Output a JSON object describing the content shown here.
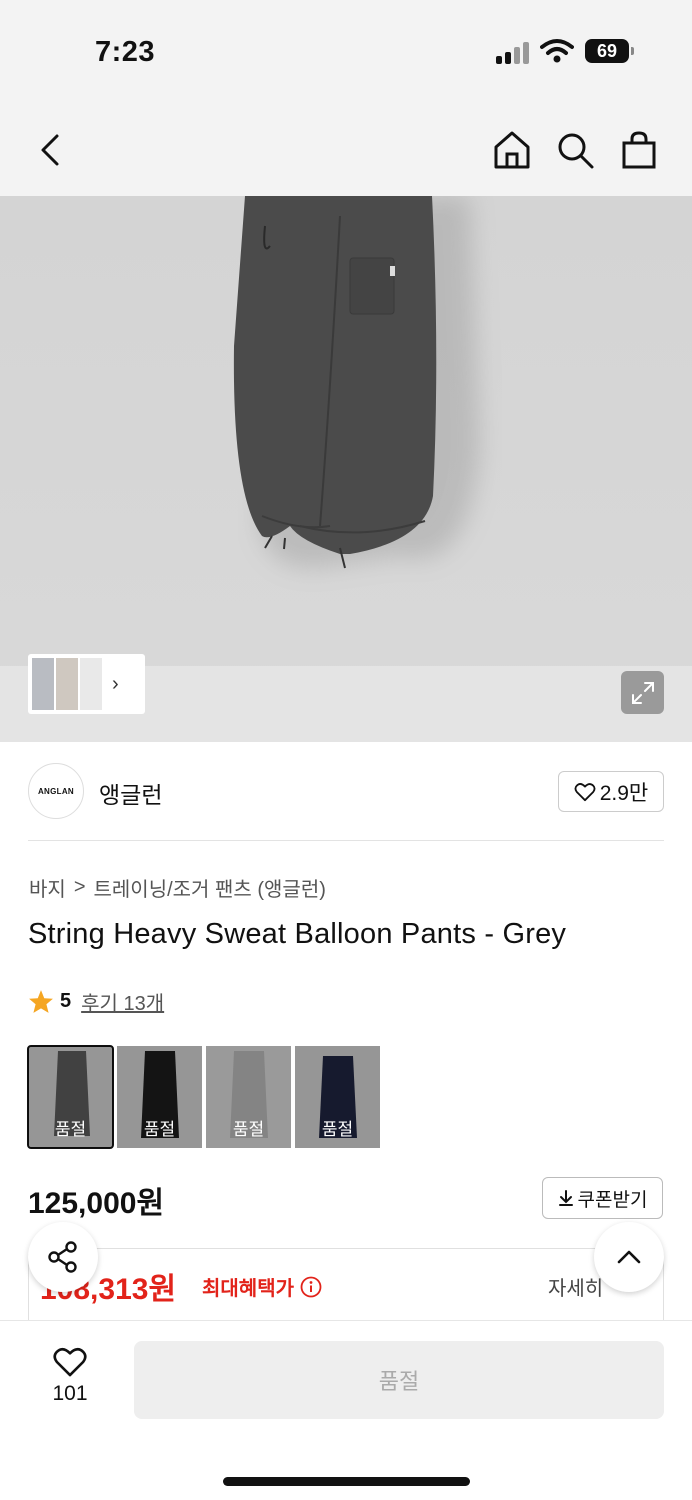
{
  "status_bar": {
    "time": "7:23",
    "battery": "69"
  },
  "nav": {
    "back_icon": "chevron-left-icon",
    "home_icon": "home-icon",
    "search_icon": "search-icon",
    "bag_icon": "shopping-bag-icon"
  },
  "gallery": {
    "thumb_chevron": "›",
    "expand_icon": "expand-icon"
  },
  "brand": {
    "logo_text": "ANGLAN",
    "name": "앵글런",
    "likes": "2.9만"
  },
  "breadcrumb": {
    "category": "바지",
    "separator": ">",
    "subcategory": "트레이닝/조거 팬츠 (앵글런)"
  },
  "product": {
    "title": "String Heavy Sweat Balloon Pants - Grey",
    "rating_score": "5",
    "reviews": "후기 13개",
    "swatches": [
      {
        "label": "품절",
        "color": "#5a5a5a"
      },
      {
        "label": "품절",
        "color": "#1c1c1c"
      },
      {
        "label": "품절",
        "color": "#b8b8b8"
      },
      {
        "label": "품절",
        "color": "#1f2540"
      }
    ],
    "price": "125,000원",
    "coupon_label": "쿠폰받기",
    "max_benefit_price": "108,313원",
    "max_benefit_label": "최대혜택가",
    "detail_label": "자세히"
  },
  "bottom": {
    "wish_count": "101",
    "soldout_label": "품절"
  },
  "colors": {
    "accent_red": "#e2231a",
    "star": "#f5a623"
  }
}
